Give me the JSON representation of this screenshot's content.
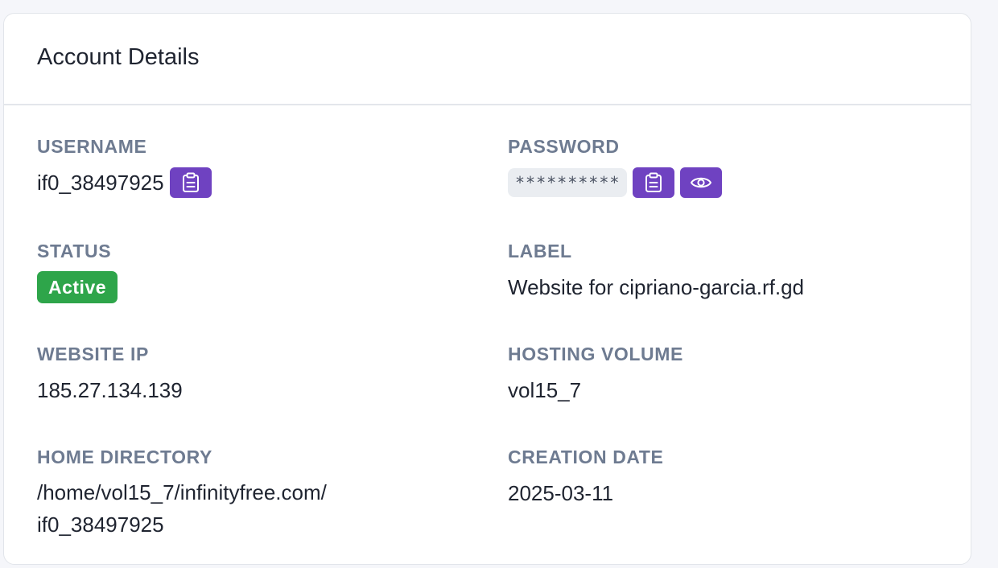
{
  "card": {
    "title": "Account Details"
  },
  "fields": {
    "username": {
      "label": "USERNAME",
      "value": "if0_38497925",
      "copy_icon": "clipboard-icon"
    },
    "password": {
      "label": "PASSWORD",
      "value": "**********",
      "copy_icon": "clipboard-icon",
      "reveal_icon": "eye-icon"
    },
    "status": {
      "label": "STATUS",
      "value": "Active",
      "color": "#2ea54a"
    },
    "label": {
      "label": "LABEL",
      "value": "Website for cipriano-garcia.rf.gd"
    },
    "website_ip": {
      "label": "WEBSITE IP",
      "value": "185.27.134.139"
    },
    "hosting_volume": {
      "label": "HOSTING VOLUME",
      "value": "vol15_7"
    },
    "home_directory": {
      "label": "HOME DIRECTORY",
      "value_line1": "/home/vol15_7/infinityfree.com/",
      "value_line2": "if0_38497925"
    },
    "creation_date": {
      "label": "CREATION DATE",
      "value": "2025-03-11"
    }
  },
  "colors": {
    "accent": "#6f42c1",
    "label": "#6e7b91",
    "text": "#1f2430",
    "success": "#2ea54a"
  }
}
